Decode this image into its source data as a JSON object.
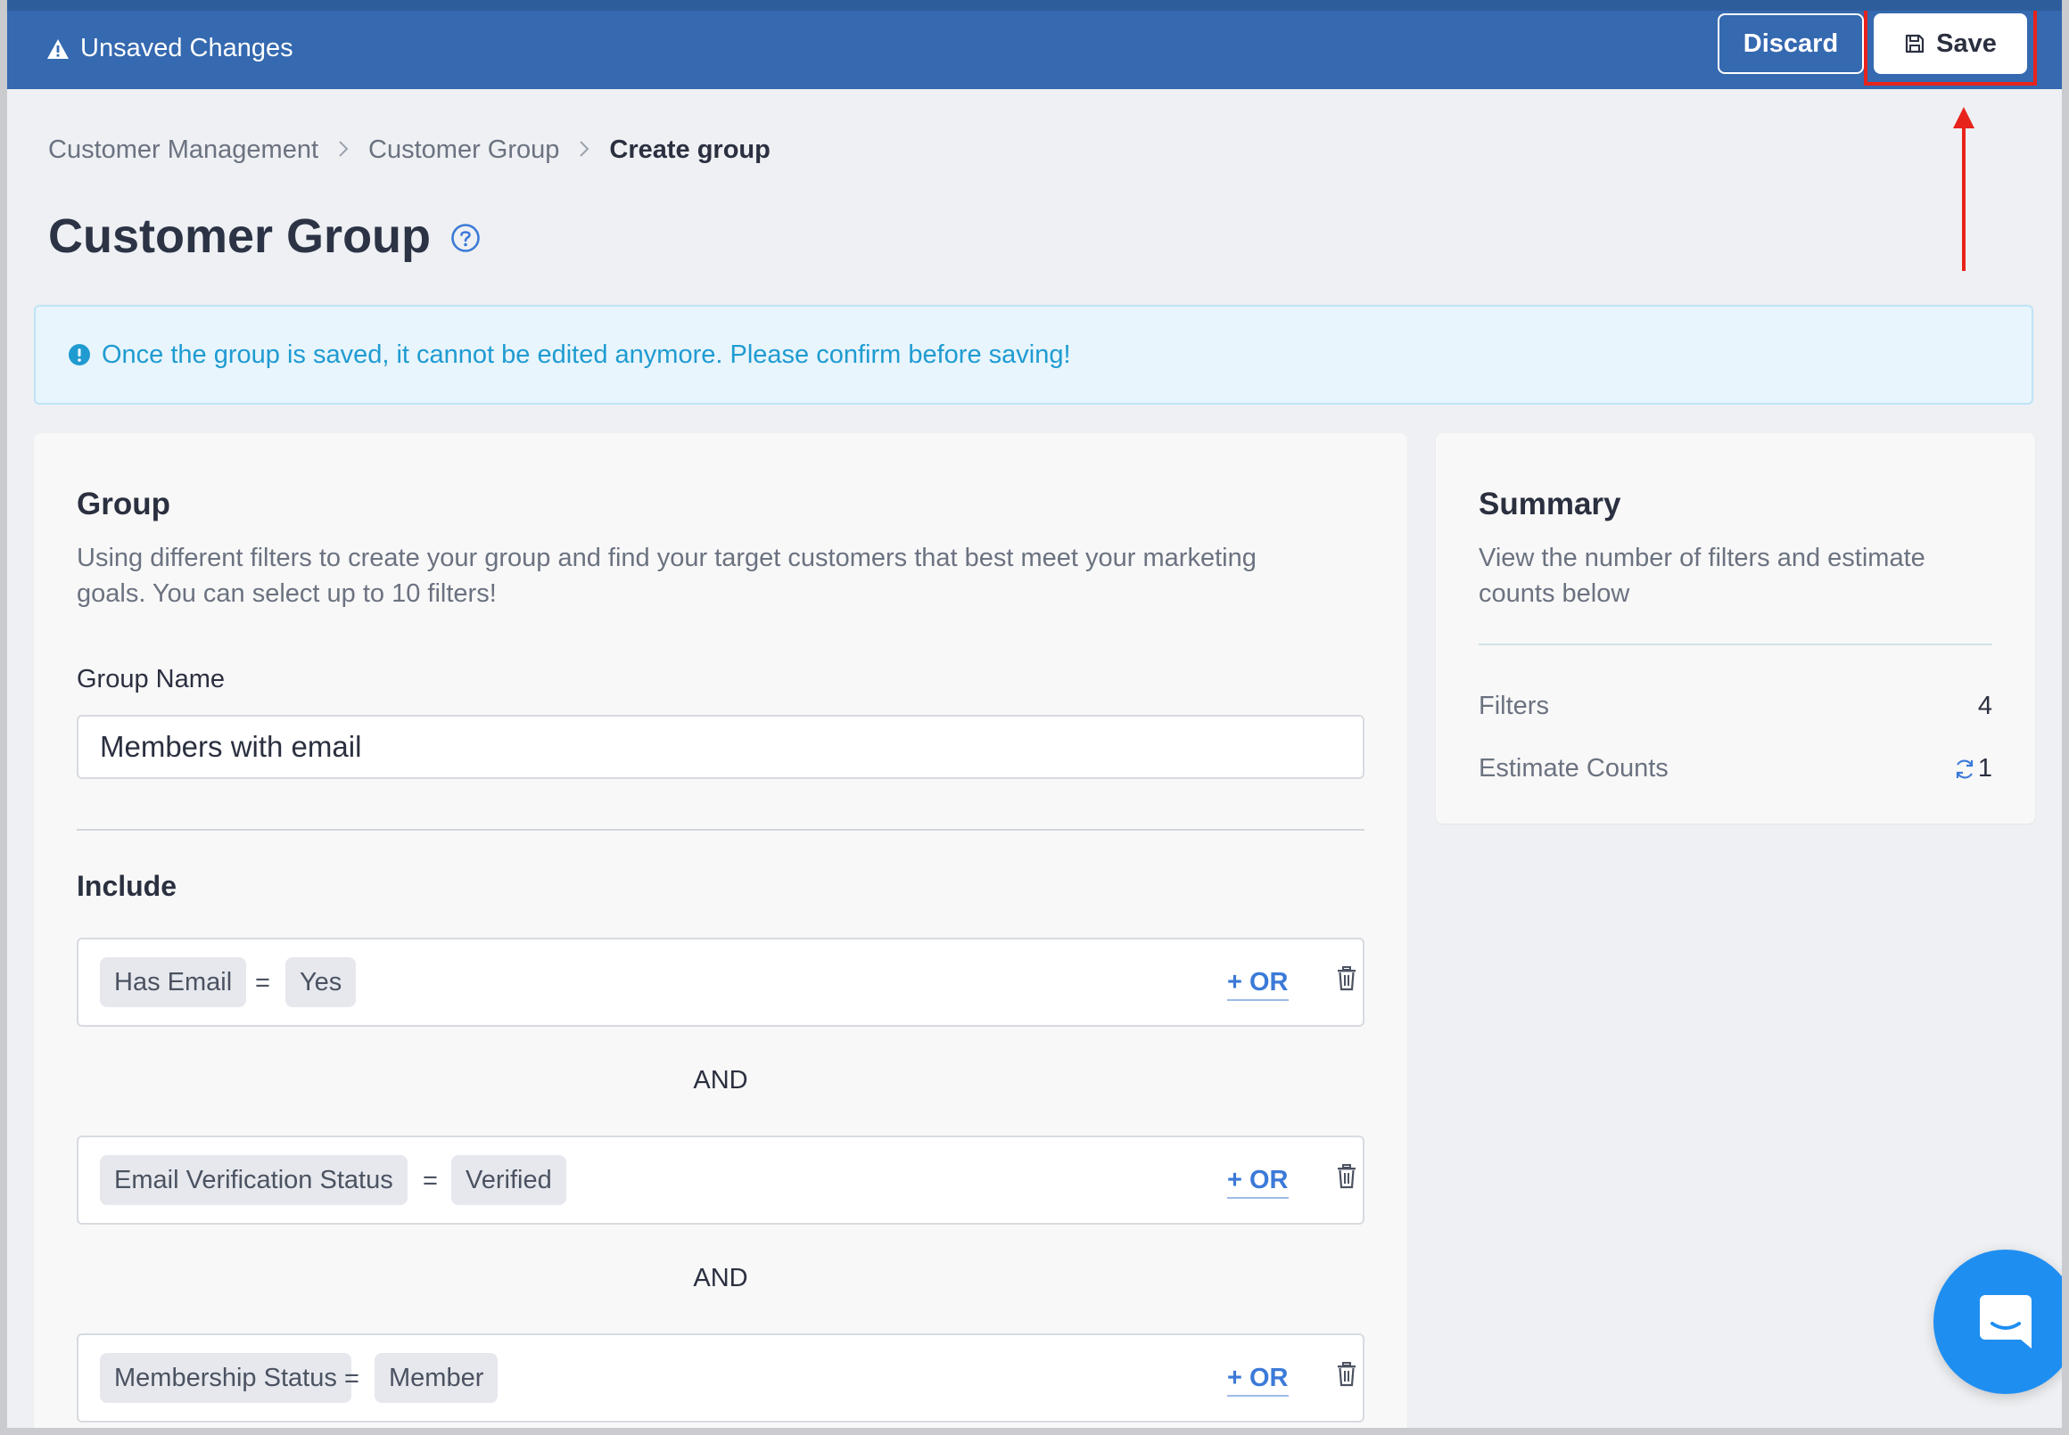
{
  "topbar": {
    "unsaved_label": "Unsaved Changes",
    "discard_label": "Discard",
    "save_label": "Save"
  },
  "breadcrumb": [
    "Customer Management",
    "Customer Group",
    "Create group"
  ],
  "page": {
    "title": "Customer Group"
  },
  "alert": {
    "message": "Once the group is saved, it cannot be edited anymore. Please confirm before saving!"
  },
  "group": {
    "title": "Group",
    "description_line1": "Using different filters to create your group and find your target customers that best meet your marketing",
    "description_line2": "goals. You can select up to 10 filters!",
    "name_label": "Group Name",
    "name_value": "Members with email",
    "include_label": "Include",
    "and_label": "AND",
    "or_label": "+ OR",
    "filters": [
      {
        "field": "Has Email",
        "op": "=",
        "value": "Yes"
      },
      {
        "field": "Email Verification Status",
        "op": "=",
        "value": "Verified"
      },
      {
        "field": "Membership Status",
        "op": "=",
        "value": "Member"
      }
    ]
  },
  "summary": {
    "title": "Summary",
    "description_line1": "View the number of filters and estimate",
    "description_line2": "counts below",
    "filters_label": "Filters",
    "filters_value": "4",
    "estimate_label": "Estimate Counts",
    "estimate_value": "1"
  },
  "colors": {
    "topbar": "#3569b0",
    "highlight": "#e8231b",
    "accent": "#3b7ad8",
    "alert_text": "#1f9bd1",
    "chat": "#1f8ef1"
  },
  "icons": [
    "warning-icon",
    "floppy-disk-icon",
    "help-circle-icon",
    "info-circle-icon",
    "trash-icon",
    "refresh-icon",
    "chat-icon",
    "chevron-right-icon"
  ]
}
